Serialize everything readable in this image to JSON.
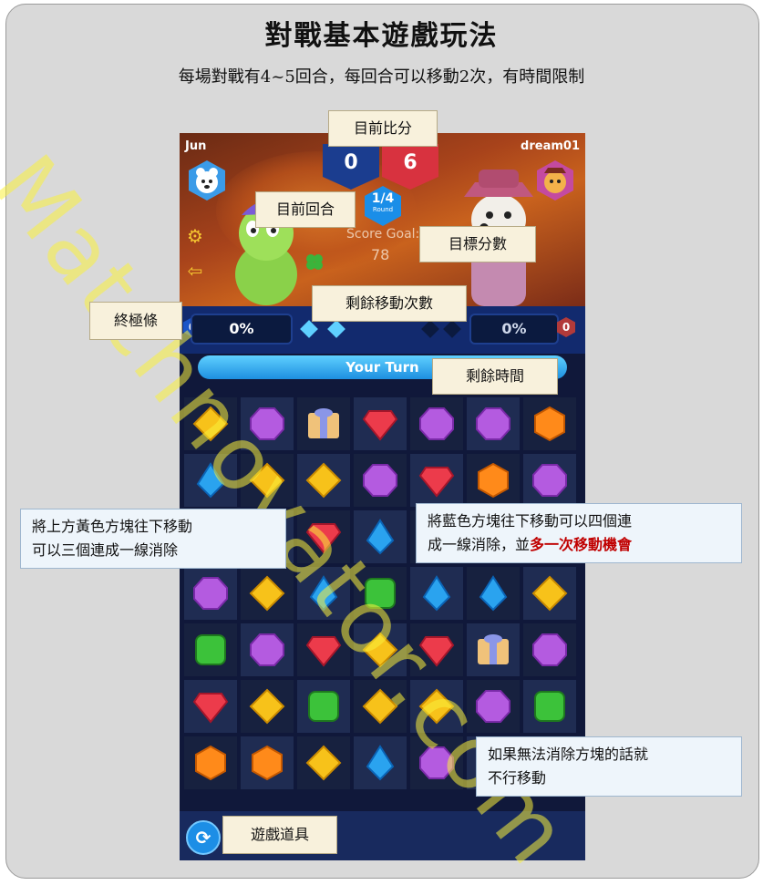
{
  "header": {
    "title": "對戰基本遊戲玩法",
    "subtitle": "每場對戰有4~5回合，每回合可以移動2次，有時間限制"
  },
  "game": {
    "player_left": "Jun",
    "player_right": "dream01",
    "score_left": "0",
    "score_right": "6",
    "round_value": "1/4",
    "round_label": "Round",
    "score_goal_label": "Score Goal:",
    "score_goal_value": "78",
    "badge_left": "0",
    "badge_right": "0",
    "meter_left": "0%",
    "meter_right": "0%",
    "turn_label": "Your Turn",
    "colors": {
      "score_left_bg": "#1b3d8f",
      "score_right_bg": "#d8323f",
      "accent": "#1c8ee6"
    }
  },
  "callouts": {
    "current_score": "目前比分",
    "current_round": "目前回合",
    "target_score": "目標分數",
    "ultimate_bar": "終極條",
    "remaining_moves": "剩餘移動次數",
    "remaining_time": "剩餘時間",
    "game_items": "遊戲道具"
  },
  "notes": {
    "yellow_move": [
      "將上方黃色方塊往下移動",
      "可以三個連成一線消除"
    ],
    "blue_move_line1": "將藍色方塊往下移動可以四個連",
    "blue_move_line2a": "成一線消除，並",
    "blue_move_line2b": "多一次移動機會",
    "no_match": [
      "如果無法消除方塊的話就",
      "不行移動"
    ]
  },
  "watermark": "Matchnovator.com",
  "board": {
    "rows": [
      [
        "yellow",
        "purple",
        "gift",
        "red",
        "purple",
        "purple",
        "orange"
      ],
      [
        "blue",
        "yellow",
        "yellow",
        "purple",
        "red",
        "orange",
        "purple"
      ],
      [
        "purple",
        "yellow",
        "red",
        "blue",
        "yellow",
        "yellow",
        "purple"
      ],
      [
        "purple",
        "yellow",
        "blue",
        "green",
        "blue",
        "blue",
        "yellow"
      ],
      [
        "green",
        "purple",
        "red",
        "yellow",
        "red",
        "gift",
        "purple"
      ],
      [
        "red",
        "yellow",
        "green",
        "yellow",
        "yellow",
        "purple",
        "green"
      ],
      [
        "orange",
        "orange",
        "yellow",
        "blue",
        "purple",
        "red",
        "yellow"
      ]
    ]
  },
  "icons": [
    "gear-icon",
    "exit-icon",
    "refresh-icon",
    "bear-avatar-icon",
    "dog-avatar-icon",
    "clover-icon"
  ]
}
